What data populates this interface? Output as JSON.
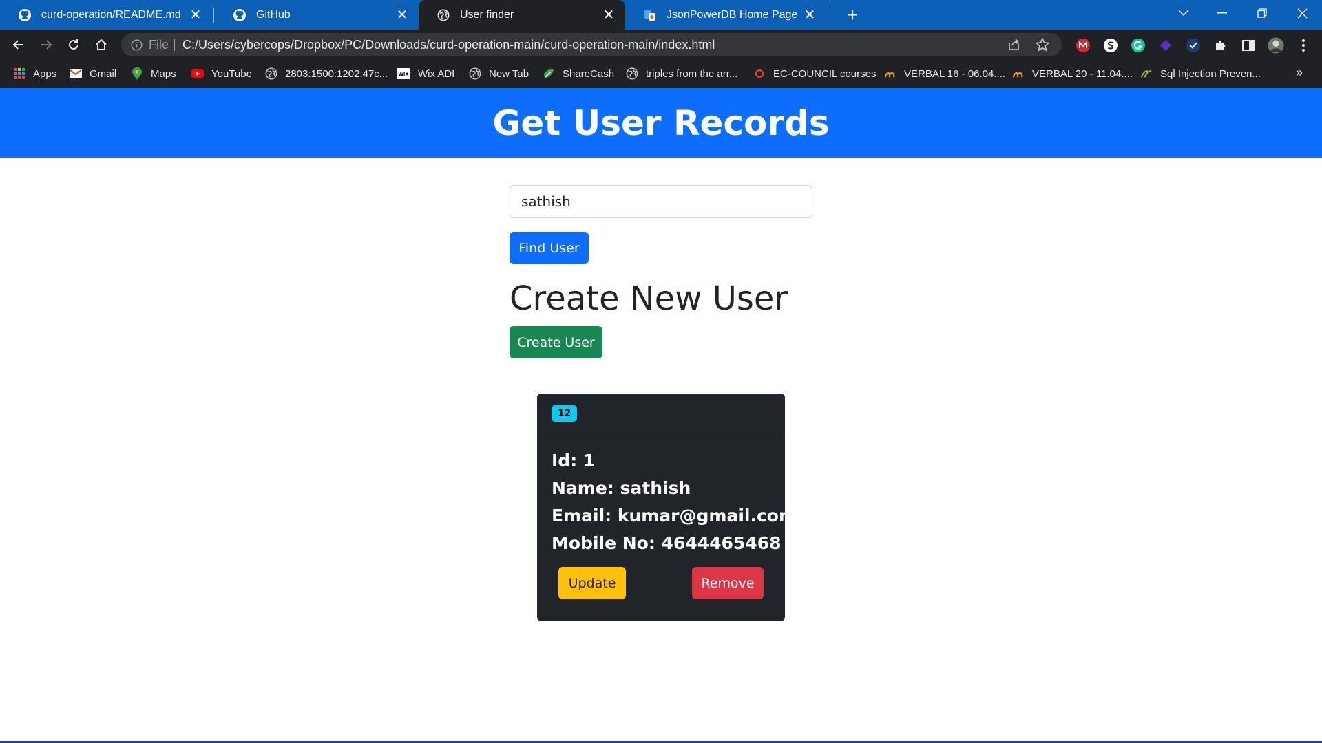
{
  "browser": {
    "tabs": [
      {
        "title": "curd-operation/README.md at m",
        "icon": "github-icon"
      },
      {
        "title": "GitHub",
        "icon": "github-icon"
      },
      {
        "title": "User finder",
        "icon": "globe-icon",
        "active": true
      },
      {
        "title": "JsonPowerDB Home Page",
        "icon": "jsonpowerdb-icon"
      }
    ],
    "address": {
      "scheme_label": "File",
      "url": "C:/Users/cybercops/Dropbox/PC/Downloads/curd-operation-main/curd-operation-main/index.html"
    },
    "bookmarks": [
      {
        "label": "Apps",
        "icon": "apps-grid-icon"
      },
      {
        "label": "Gmail",
        "icon": "gmail-icon"
      },
      {
        "label": "Maps",
        "icon": "maps-pin-icon"
      },
      {
        "label": "YouTube",
        "icon": "youtube-icon"
      },
      {
        "label": "2803:1500:1202:47c...",
        "icon": "globe-icon"
      },
      {
        "label": "Wix ADI",
        "icon": "wix-icon"
      },
      {
        "label": "New Tab",
        "icon": "globe-icon"
      },
      {
        "label": "ShareCash",
        "icon": "sharecash-icon"
      },
      {
        "label": "triples from the arr...",
        "icon": "globe-icon"
      },
      {
        "label": "EC-COUNCIL courses",
        "icon": "ec-council-icon"
      },
      {
        "label": "VERBAL 16 - 06.04....",
        "icon": "verbal-icon"
      },
      {
        "label": "VERBAL 20 - 11.04....",
        "icon": "verbal-icon"
      },
      {
        "label": "Sql Injection Preven...",
        "icon": "sql-icon"
      }
    ],
    "more_bookmarks": "»"
  },
  "colors": {
    "header_bg": "#0d6efd",
    "primary": "#0d6efd",
    "success": "#198754",
    "warning": "#ffc107",
    "danger": "#dc3545",
    "info_badge": "#0dcaf0",
    "card_bg": "#212529"
  },
  "page": {
    "header_title": "Get User Records",
    "search_value": "sathish",
    "find_button": "Find User",
    "create_title": "Create New User",
    "create_button": "Create User"
  },
  "card": {
    "badge": "12",
    "id_line": "Id: 1",
    "name_line": "Name: sathish",
    "email_line": "Email: kumar@gmail.com",
    "mobile_line": "Mobile No: 4644465468",
    "update_button": "Update",
    "remove_button": "Remove"
  }
}
